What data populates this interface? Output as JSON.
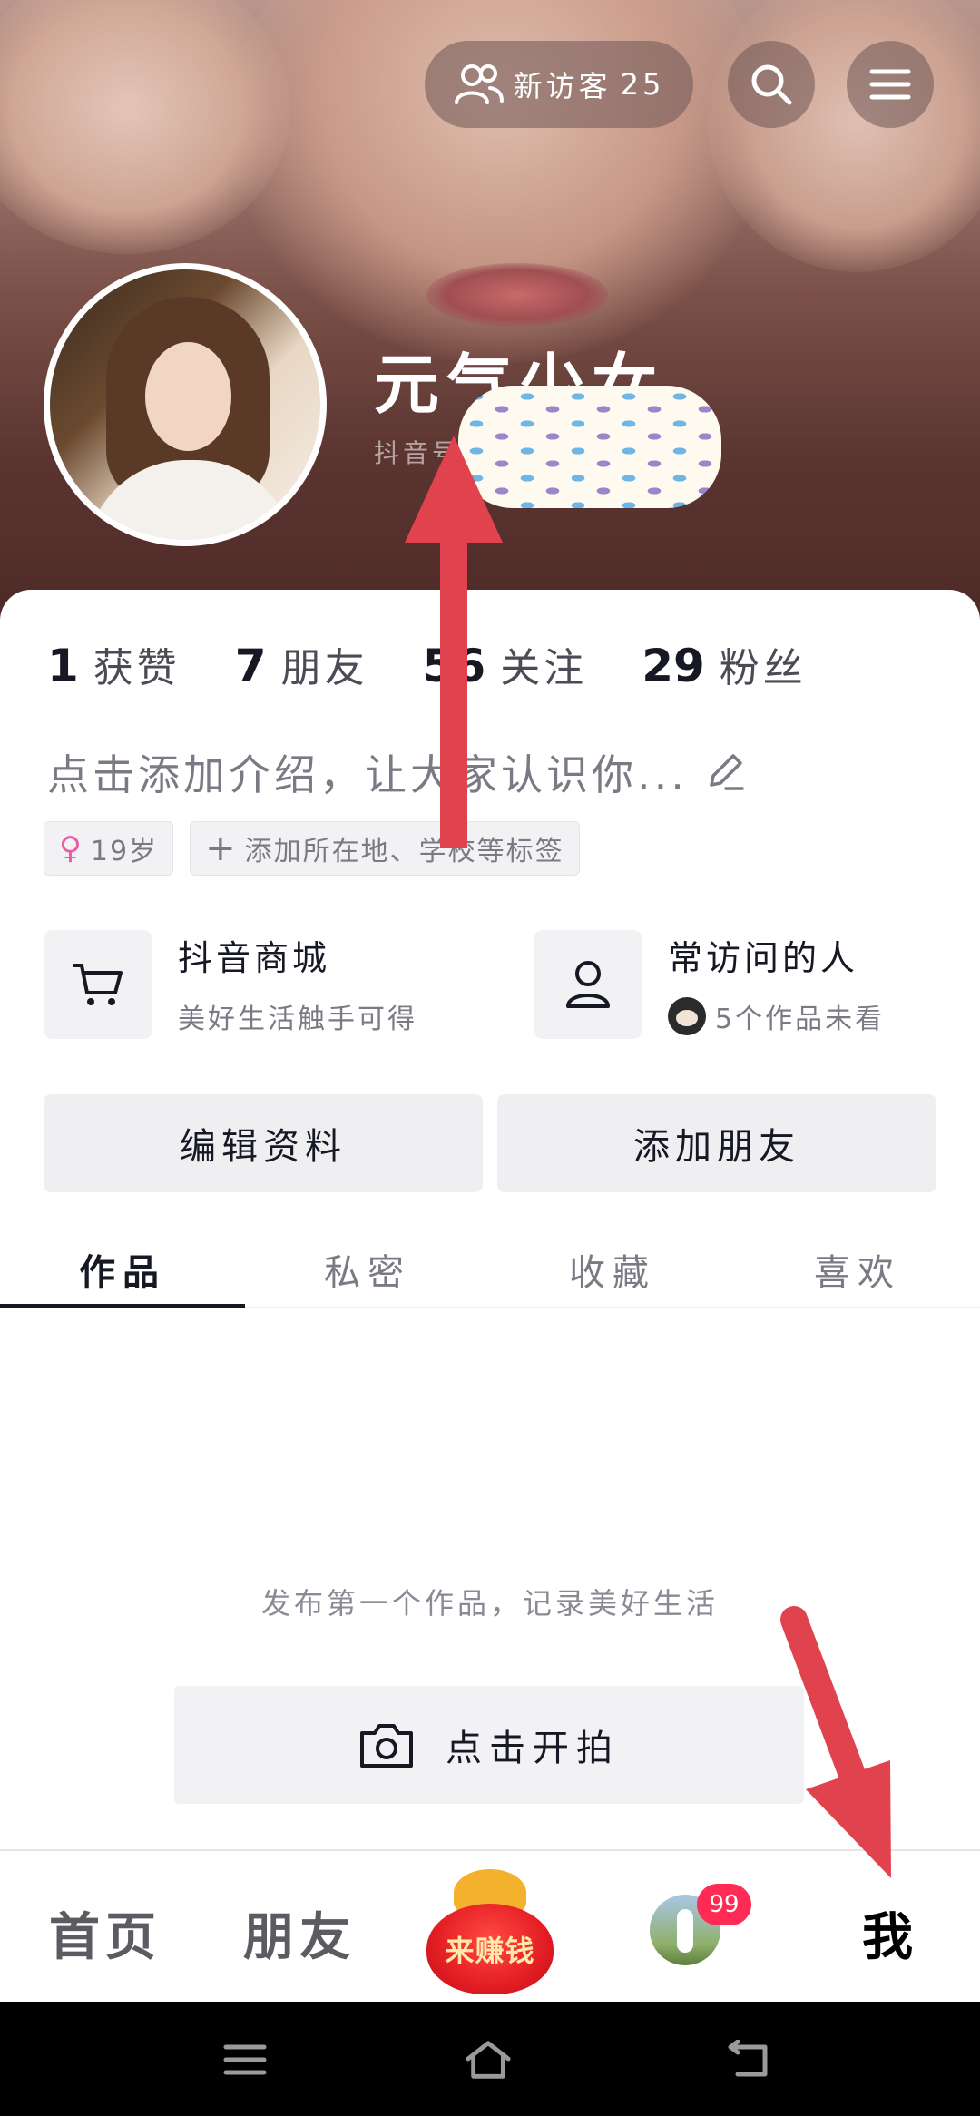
{
  "header": {
    "visitors_label": "新访客",
    "visitors_count": "25",
    "nickname": "元气少女",
    "douyin_id_prefix": "抖音号"
  },
  "stats": [
    {
      "num": "1",
      "label": "获赞"
    },
    {
      "num": "7",
      "label": "朋友"
    },
    {
      "num": "56",
      "label": "关注"
    },
    {
      "num": "29",
      "label": "粉丝"
    }
  ],
  "profile": {
    "intro_placeholder": "点击添加介绍，让大家认识你...",
    "age_tag": "19岁",
    "add_tag_label": "添加所在地、学校等标签"
  },
  "shortcuts": {
    "mall": {
      "title": "抖音商城",
      "subtitle": "美好生活触手可得"
    },
    "visitors": {
      "title": "常访问的人",
      "subtitle": "5个作品未看"
    }
  },
  "actions": {
    "edit_profile": "编辑资料",
    "add_friend": "添加朋友"
  },
  "tabs": [
    "作品",
    "私密",
    "收藏",
    "喜欢"
  ],
  "content": {
    "empty_hint": "发布第一个作品，记录美好生活",
    "shoot_label": "点击开拍"
  },
  "bottom_nav": {
    "home": "首页",
    "friends": "朋友",
    "earn": "来赚钱",
    "message_badge": "99",
    "me": "我"
  },
  "colors": {
    "accent": "#fe2c55",
    "arrow": "#e0424e",
    "text_primary": "#161823",
    "text_secondary": "#7a7a85"
  }
}
